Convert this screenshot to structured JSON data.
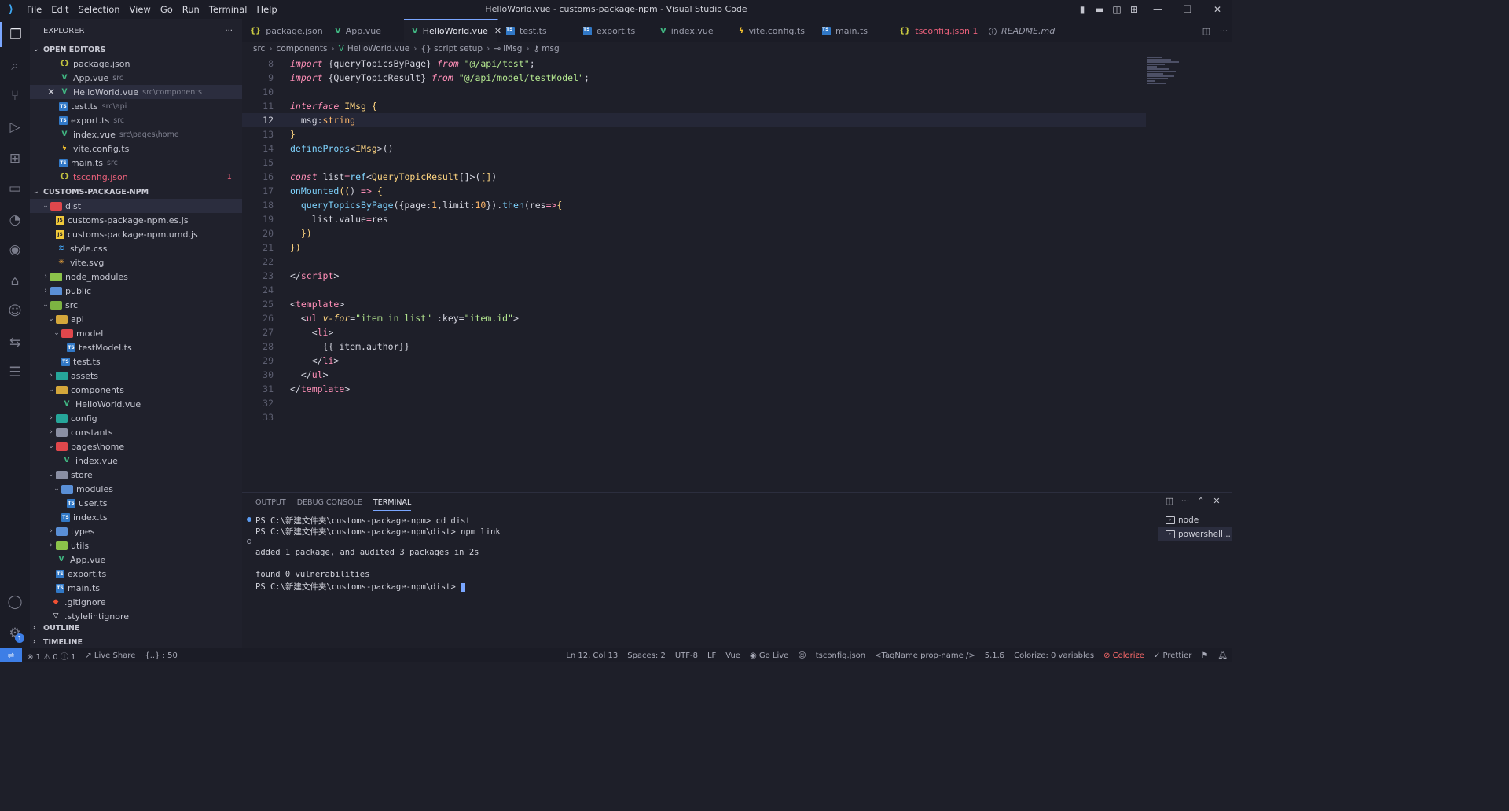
{
  "window": {
    "title": "HelloWorld.vue - customs-package-npm - Visual Studio Code",
    "menu": [
      "File",
      "Edit",
      "Selection",
      "View",
      "Go",
      "Run",
      "Terminal",
      "Help"
    ]
  },
  "sidebar": {
    "title": "EXPLORER",
    "open_editors_label": "OPEN EDITORS",
    "open_editors": [
      {
        "name": "package.json",
        "desc": "",
        "icon": "json"
      },
      {
        "name": "App.vue",
        "desc": "src",
        "icon": "vue"
      },
      {
        "name": "HelloWorld.vue",
        "desc": "src\\components",
        "icon": "vue",
        "selected": true
      },
      {
        "name": "test.ts",
        "desc": "src\\api",
        "icon": "ts"
      },
      {
        "name": "export.ts",
        "desc": "src",
        "icon": "ts"
      },
      {
        "name": "index.vue",
        "desc": "src\\pages\\home",
        "icon": "vue"
      },
      {
        "name": "vite.config.ts",
        "desc": "",
        "icon": "vite"
      },
      {
        "name": "main.ts",
        "desc": "src",
        "icon": "ts"
      },
      {
        "name": "tsconfig.json",
        "desc": "",
        "icon": "json",
        "error": true,
        "count": "1"
      }
    ],
    "project_label": "CUSTOMS-PACKAGE-NPM",
    "tree": [
      {
        "name": "dist",
        "depth": 0,
        "type": "folder",
        "open": true,
        "color": "red",
        "selected": true
      },
      {
        "name": "customs-package-npm.es.js",
        "depth": 1,
        "type": "js"
      },
      {
        "name": "customs-package-npm.umd.js",
        "depth": 1,
        "type": "js"
      },
      {
        "name": "style.css",
        "depth": 1,
        "type": "css"
      },
      {
        "name": "vite.svg",
        "depth": 1,
        "type": "svg"
      },
      {
        "name": "node_modules",
        "depth": 0,
        "type": "folder",
        "open": false,
        "color": "lime"
      },
      {
        "name": "public",
        "depth": 0,
        "type": "folder",
        "open": false,
        "color": "blue"
      },
      {
        "name": "src",
        "depth": 0,
        "type": "folder",
        "open": true,
        "color": "green"
      },
      {
        "name": "api",
        "depth": 1,
        "type": "folder",
        "open": true,
        "color": "yellow"
      },
      {
        "name": "model",
        "depth": 2,
        "type": "folder",
        "open": true,
        "color": "red"
      },
      {
        "name": "testModel.ts",
        "depth": 3,
        "type": "ts"
      },
      {
        "name": "test.ts",
        "depth": 2,
        "type": "ts"
      },
      {
        "name": "assets",
        "depth": 1,
        "type": "folder",
        "open": false,
        "color": "teal"
      },
      {
        "name": "components",
        "depth": 1,
        "type": "folder",
        "open": true,
        "color": "yellow"
      },
      {
        "name": "HelloWorld.vue",
        "depth": 2,
        "type": "vue"
      },
      {
        "name": "config",
        "depth": 1,
        "type": "folder",
        "open": false,
        "color": "teal"
      },
      {
        "name": "constants",
        "depth": 1,
        "type": "folder",
        "open": false,
        "color": "gray"
      },
      {
        "name": "pages\\home",
        "depth": 1,
        "type": "folder",
        "open": true,
        "color": "red"
      },
      {
        "name": "index.vue",
        "depth": 2,
        "type": "vue"
      },
      {
        "name": "store",
        "depth": 1,
        "type": "folder",
        "open": true,
        "color": "gray"
      },
      {
        "name": "modules",
        "depth": 2,
        "type": "folder",
        "open": true,
        "color": "blue"
      },
      {
        "name": "user.ts",
        "depth": 3,
        "type": "ts"
      },
      {
        "name": "index.ts",
        "depth": 2,
        "type": "ts"
      },
      {
        "name": "types",
        "depth": 1,
        "type": "folder",
        "open": false,
        "color": "blue"
      },
      {
        "name": "utils",
        "depth": 1,
        "type": "folder",
        "open": false,
        "color": "lime"
      },
      {
        "name": "App.vue",
        "depth": 1,
        "type": "vue"
      },
      {
        "name": "export.ts",
        "depth": 1,
        "type": "ts"
      },
      {
        "name": "main.ts",
        "depth": 1,
        "type": "ts"
      },
      {
        "name": ".gitignore",
        "depth": 0,
        "type": "git"
      },
      {
        "name": ".stylelintignore",
        "depth": 0,
        "type": "style"
      }
    ],
    "outline_label": "OUTLINE",
    "timeline_label": "TIMELINE"
  },
  "tabs": [
    {
      "name": "package.json",
      "icon": "json"
    },
    {
      "name": "App.vue",
      "icon": "vue"
    },
    {
      "name": "HelloWorld.vue",
      "icon": "vue",
      "active": true
    },
    {
      "name": "test.ts",
      "icon": "ts"
    },
    {
      "name": "export.ts",
      "icon": "ts"
    },
    {
      "name": "index.vue",
      "icon": "vue"
    },
    {
      "name": "vite.config.ts",
      "icon": "vite"
    },
    {
      "name": "main.ts",
      "icon": "ts"
    },
    {
      "name": "tsconfig.json 1",
      "icon": "json",
      "error": true
    },
    {
      "name": "README.md",
      "icon": "info",
      "italic": true
    }
  ],
  "breadcrumb": [
    "src",
    "components",
    "HelloWorld.vue",
    "{} script setup",
    "IMsg",
    "msg"
  ],
  "editor": {
    "current_line": 12,
    "lines": [
      {
        "n": 8,
        "t": [
          [
            "kw",
            "import"
          ],
          [
            "plain",
            " {"
          ],
          [
            "ident",
            "queryTopicsByPage"
          ],
          [
            "plain",
            "} "
          ],
          [
            "kw",
            "from"
          ],
          [
            "plain",
            " "
          ],
          [
            "str",
            "\"@/api/test\""
          ],
          [
            "plain",
            ";"
          ]
        ]
      },
      {
        "n": 9,
        "t": [
          [
            "kw",
            "import"
          ],
          [
            "plain",
            " {"
          ],
          [
            "ident",
            "QueryTopicResult"
          ],
          [
            "plain",
            "} "
          ],
          [
            "kw",
            "from"
          ],
          [
            "plain",
            " "
          ],
          [
            "str",
            "\"@/api/model/testModel\""
          ],
          [
            "plain",
            ";"
          ]
        ]
      },
      {
        "n": 10,
        "t": []
      },
      {
        "n": 11,
        "t": [
          [
            "kw",
            "interface"
          ],
          [
            "plain",
            " "
          ],
          [
            "ty",
            "IMsg"
          ],
          [
            "plain",
            " "
          ],
          [
            "brk",
            "{"
          ]
        ]
      },
      {
        "n": 12,
        "t": [
          [
            "plain",
            "  msg:"
          ],
          [
            "num",
            "string"
          ]
        ]
      },
      {
        "n": 13,
        "t": [
          [
            "brk",
            "}"
          ]
        ]
      },
      {
        "n": 14,
        "t": [
          [
            "fn",
            "defineProps"
          ],
          [
            "plain",
            "<"
          ],
          [
            "ty",
            "IMsg"
          ],
          [
            "plain",
            ">()"
          ]
        ]
      },
      {
        "n": 15,
        "t": []
      },
      {
        "n": 16,
        "t": [
          [
            "kw",
            "const"
          ],
          [
            "plain",
            " "
          ],
          [
            "ident",
            "list"
          ],
          [
            "tag",
            "="
          ],
          [
            "fn",
            "ref"
          ],
          [
            "plain",
            "<"
          ],
          [
            "ty",
            "QueryTopicResult"
          ],
          [
            "plain",
            "[]>("
          ],
          [
            "brk",
            "[]"
          ],
          [
            "plain",
            ")"
          ]
        ]
      },
      {
        "n": 17,
        "t": [
          [
            "fn",
            "onMounted"
          ],
          [
            "brk",
            "(("
          ],
          [
            "plain",
            ") "
          ],
          [
            "tag",
            "=>"
          ],
          [
            "plain",
            " "
          ],
          [
            "brk",
            "{"
          ]
        ]
      },
      {
        "n": 18,
        "t": [
          [
            "plain",
            "  "
          ],
          [
            "fn",
            "queryTopicsByPage"
          ],
          [
            "plain",
            "({"
          ],
          [
            "ident",
            "page"
          ],
          [
            "plain",
            ":"
          ],
          [
            "num",
            "1"
          ],
          [
            "plain",
            ","
          ],
          [
            "ident",
            "limit"
          ],
          [
            "plain",
            ":"
          ],
          [
            "num",
            "10"
          ],
          [
            "plain",
            "})."
          ],
          [
            "fn",
            "then"
          ],
          [
            "plain",
            "("
          ],
          [
            "ident",
            "res"
          ],
          [
            "tag",
            "=>"
          ],
          [
            "brk",
            "{"
          ]
        ]
      },
      {
        "n": 19,
        "t": [
          [
            "plain",
            "    "
          ],
          [
            "ident",
            "list"
          ],
          [
            "plain",
            "."
          ],
          [
            "ident",
            "value"
          ],
          [
            "tag",
            "="
          ],
          [
            "ident",
            "res"
          ]
        ]
      },
      {
        "n": 20,
        "t": [
          [
            "plain",
            "  "
          ],
          [
            "brk",
            "})"
          ]
        ]
      },
      {
        "n": 21,
        "t": [
          [
            "brk",
            "})"
          ]
        ]
      },
      {
        "n": 22,
        "t": []
      },
      {
        "n": 23,
        "t": [
          [
            "plain",
            "</"
          ],
          [
            "tag",
            "script"
          ],
          [
            "plain",
            ">"
          ]
        ]
      },
      {
        "n": 24,
        "t": []
      },
      {
        "n": 25,
        "t": [
          [
            "plain",
            "<"
          ],
          [
            "tag",
            "template"
          ],
          [
            "plain",
            ">"
          ]
        ]
      },
      {
        "n": 26,
        "t": [
          [
            "plain",
            "  <"
          ],
          [
            "tag",
            "ul"
          ],
          [
            "plain",
            " "
          ],
          [
            "attr",
            "v-for"
          ],
          [
            "plain",
            "="
          ],
          [
            "str",
            "\"item in list\""
          ],
          [
            "plain",
            " :key="
          ],
          [
            "str",
            "\"item.id\""
          ],
          [
            "plain",
            ">"
          ]
        ]
      },
      {
        "n": 27,
        "t": [
          [
            "plain",
            "    <"
          ],
          [
            "tag",
            "li"
          ],
          [
            "plain",
            ">"
          ]
        ]
      },
      {
        "n": 28,
        "t": [
          [
            "plain",
            "      {{ "
          ],
          [
            "ident",
            "item"
          ],
          [
            "plain",
            "."
          ],
          [
            "ident",
            "author"
          ],
          [
            "plain",
            "}}"
          ]
        ]
      },
      {
        "n": 29,
        "t": [
          [
            "plain",
            "    </"
          ],
          [
            "tag",
            "li"
          ],
          [
            "plain",
            ">"
          ]
        ]
      },
      {
        "n": 30,
        "t": [
          [
            "plain",
            "  </"
          ],
          [
            "tag",
            "ul"
          ],
          [
            "plain",
            ">"
          ]
        ]
      },
      {
        "n": 31,
        "t": [
          [
            "plain",
            "</"
          ],
          [
            "tag",
            "template"
          ],
          [
            "plain",
            ">"
          ]
        ]
      },
      {
        "n": 32,
        "t": []
      },
      {
        "n": 33,
        "t": []
      }
    ]
  },
  "panel": {
    "tabs": [
      "OUTPUT",
      "DEBUG CONSOLE",
      "TERMINAL"
    ],
    "active_tab": "TERMINAL",
    "terminal_lines": [
      {
        "text": "PS C:\\新建文件夹\\customs-package-npm> cd dist",
        "dot": "blue"
      },
      {
        "text": "PS C:\\新建文件夹\\customs-package-npm\\dist> npm link",
        "dot": ""
      },
      {
        "text": "",
        "dot": "hollow"
      },
      {
        "text": "added 1 package, and audited 3 packages in 2s",
        "dot": ""
      },
      {
        "text": "",
        "dot": ""
      },
      {
        "text": "found 0 vulnerabilities",
        "dot": ""
      },
      {
        "text": "PS C:\\新建文件夹\\customs-package-npm\\dist> ",
        "dot": "",
        "cursor": true
      }
    ],
    "terminals": [
      {
        "name": "node"
      },
      {
        "name": "powershell...",
        "active": true
      }
    ]
  },
  "status": {
    "problems": "⊗ 1 ⚠ 0 ⓘ 1",
    "live_share": "Live Share",
    "selection": "{..} : 50",
    "position": "Ln 12, Col 13",
    "spaces": "Spaces: 2",
    "encoding": "UTF-8",
    "eol": "LF",
    "language": "Vue",
    "go_live": "Go Live",
    "tsconfig": "tsconfig.json",
    "tagname": "<TagName prop-name />",
    "version": "5.1.6",
    "colorize_vars": "Colorize: 0 variables",
    "colorize": "Colorize",
    "prettier": "Prettier"
  },
  "colors": {
    "accent": "#7aa6ff",
    "error": "#e9607a",
    "remote": "#3d7ee6"
  }
}
